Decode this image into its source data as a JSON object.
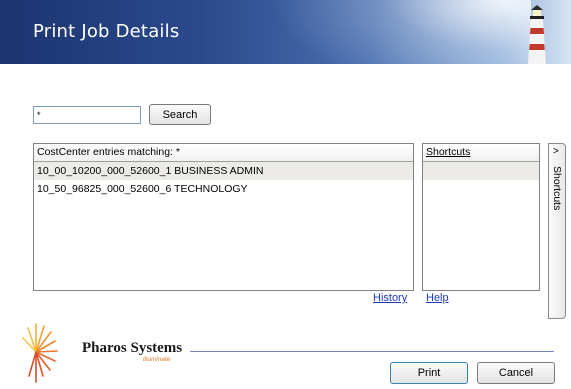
{
  "window": {
    "title": "Print Job Details"
  },
  "search": {
    "value": "*",
    "button_label": "Search"
  },
  "entries": {
    "header": "CostCenter entries matching: *",
    "rows": [
      "10_00_10200_000_52600_1 BUSINESS ADMIN",
      "10_50_96825_000_52600_6 TECHNOLOGY"
    ],
    "selected_index": 0
  },
  "shortcuts": {
    "header": "Shortcuts"
  },
  "side_panel": {
    "chevron": ">",
    "label": "Shortcuts"
  },
  "links": {
    "history": "History",
    "help": "Help"
  },
  "branding": {
    "name": "Pharos Systems",
    "tagline": "illuminate"
  },
  "actions": {
    "print_label": "Print",
    "cancel_label": "Cancel"
  },
  "colors": {
    "banner_dark": "#1c3470",
    "banner_light": "#d7e4f3",
    "link": "#1a3bbd",
    "selection": "#ecebe7",
    "brand_accent": "#e6802c"
  },
  "icons": {
    "banner": "lighthouse-icon",
    "logo": "starburst-logo-icon",
    "side_tab": "chevron-right-icon"
  }
}
